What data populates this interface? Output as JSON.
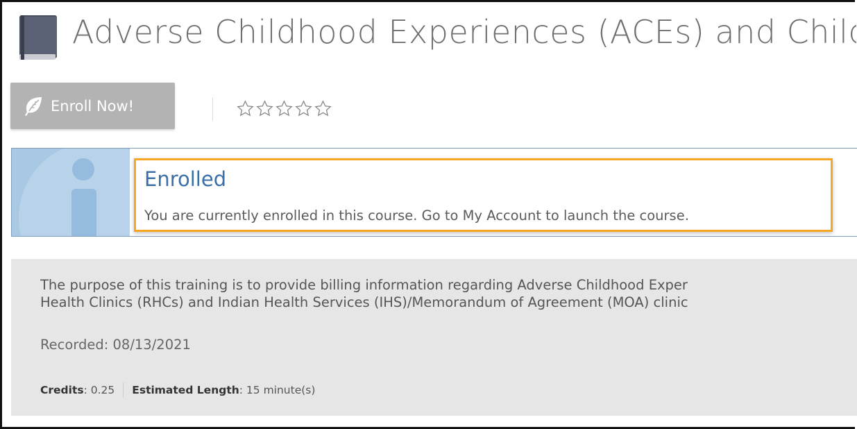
{
  "course": {
    "title": "Adverse Childhood Experiences (ACEs) and Childho",
    "icon": "book-icon"
  },
  "enroll": {
    "label": "Enroll Now!",
    "icon": "leaf-icon"
  },
  "rating": {
    "stars_total": 5,
    "stars_filled": 0
  },
  "notice": {
    "icon": "info-icon",
    "heading": "Enrolled",
    "message": "You are currently enrolled in this course. Go to My Account to launch the course.",
    "highlight_color": "#f5a623",
    "heading_color": "#3a6fa8"
  },
  "description": {
    "line1": "The purpose of this training is to provide billing information regarding Adverse Childhood Exper",
    "line2": "Health Clinics (RHCs) and Indian Health Services (IHS)/Memorandum of Agreement (MOA) clinic",
    "recorded": "Recorded: 08/13/2021",
    "credits_label": "Credits",
    "credits_value": ": 0.25",
    "length_label": "Estimated Length",
    "length_value": ": 15 minute(s)"
  }
}
